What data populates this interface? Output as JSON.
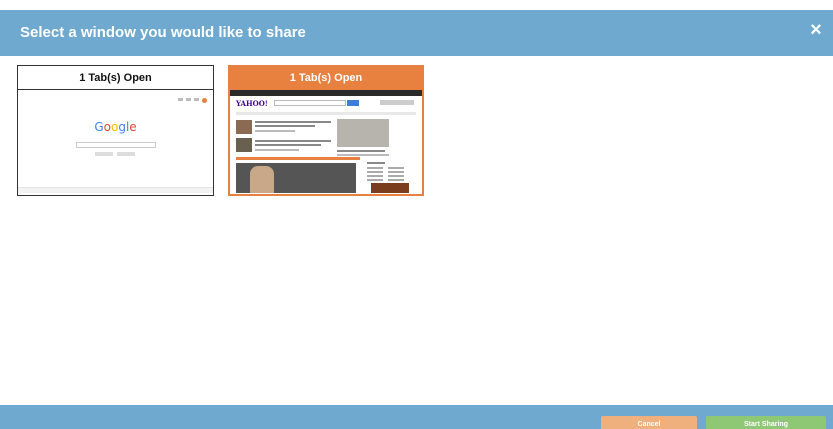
{
  "header": {
    "title": "Select a window you would like to share",
    "close_icon": "×"
  },
  "windows": [
    {
      "label": "1 Tab(s) Open",
      "preview": {
        "logo": "Google"
      },
      "selected": false
    },
    {
      "label": "1 Tab(s) Open",
      "preview": {
        "logo": "YAHOO!"
      },
      "selected": true
    }
  ],
  "footer": {
    "cancel_label": "Cancel",
    "share_label": "Start Sharing"
  },
  "colors": {
    "header_bg": "#6fa9cf",
    "selected_accent": "#e8803f",
    "cancel_bg": "#efb07e",
    "share_bg": "#8fc874"
  }
}
